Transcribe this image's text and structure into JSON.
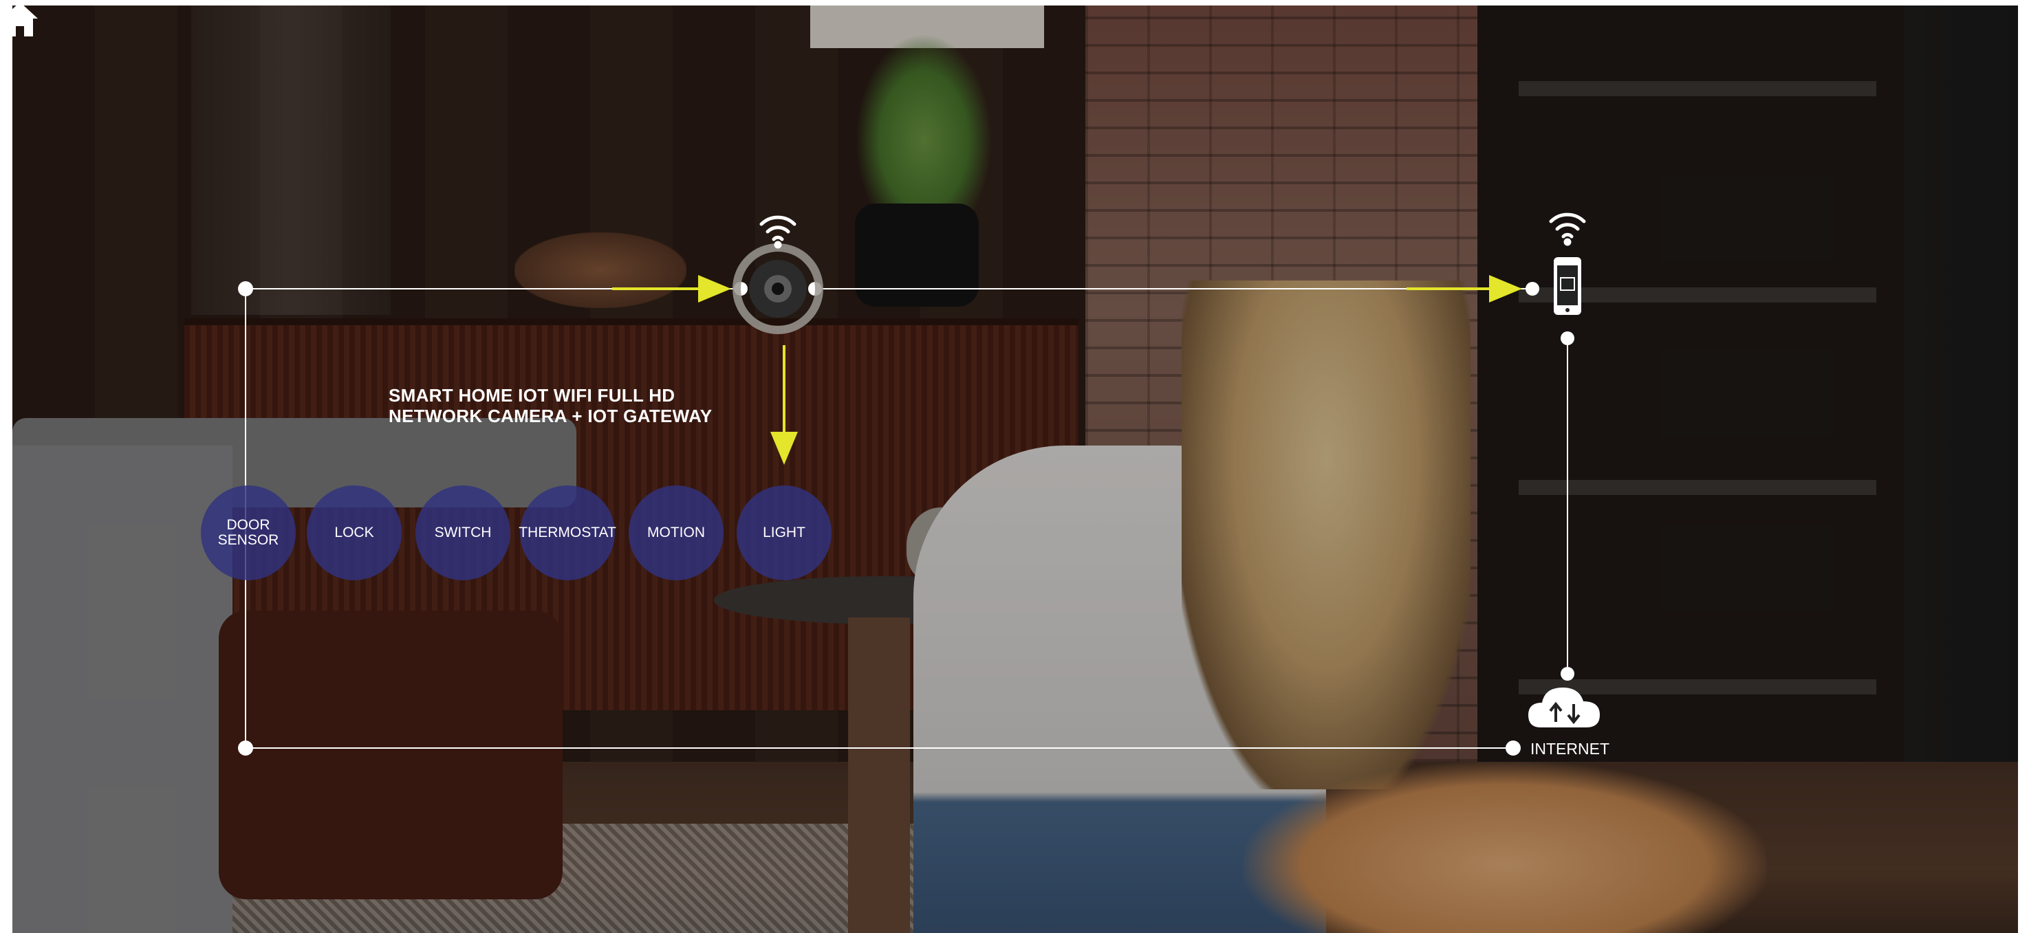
{
  "title": {
    "line1": "SMART HOME IOT WIFI FULL HD",
    "line2": "NETWORK CAMERA + IOT GATEWAY"
  },
  "devices": [
    {
      "label_line1": "DOOR",
      "label_line2": "SENSOR"
    },
    {
      "label_line1": "LOCK",
      "label_line2": ""
    },
    {
      "label_line1": "SWITCH",
      "label_line2": ""
    },
    {
      "label_line1": "THERMOSTAT",
      "label_line2": ""
    },
    {
      "label_line1": "MOTION",
      "label_line2": ""
    },
    {
      "label_line1": "LIGHT",
      "label_line2": ""
    }
  ],
  "internet_label": "INTERNET",
  "colors": {
    "node_fill": "#313280",
    "arrow": "#e3e62a",
    "line": "#ffffff"
  },
  "icons": [
    "home-icon",
    "wifi-icon",
    "camera-icon",
    "phone-icon",
    "cloud-upload-download-icon"
  ]
}
